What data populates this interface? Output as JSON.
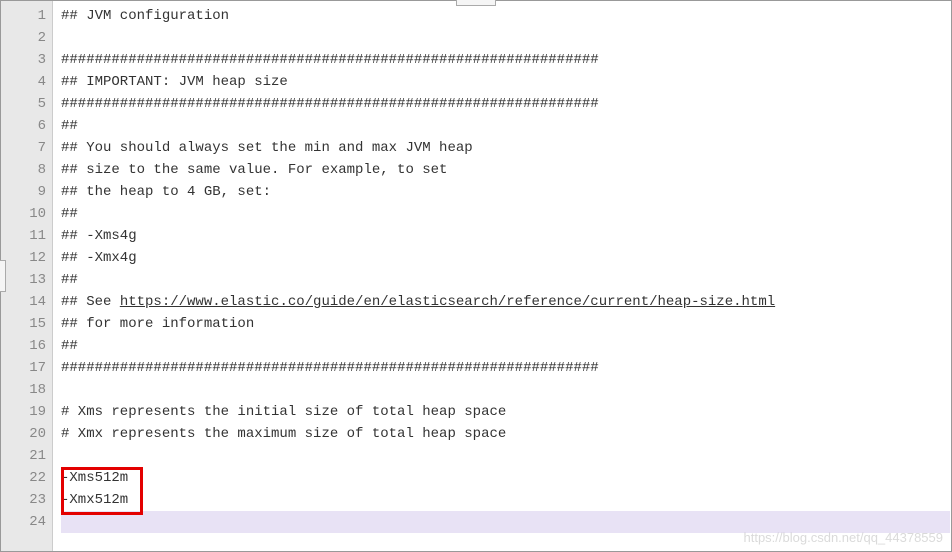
{
  "lines": [
    {
      "n": 1,
      "text": "## JVM configuration"
    },
    {
      "n": 2,
      "text": ""
    },
    {
      "n": 3,
      "text": "################################################################"
    },
    {
      "n": 4,
      "text": "## IMPORTANT: JVM heap size"
    },
    {
      "n": 5,
      "text": "################################################################"
    },
    {
      "n": 6,
      "text": "##"
    },
    {
      "n": 7,
      "text": "## You should always set the min and max JVM heap"
    },
    {
      "n": 8,
      "text": "## size to the same value. For example, to set"
    },
    {
      "n": 9,
      "text": "## the heap to 4 GB, set:"
    },
    {
      "n": 10,
      "text": "##"
    },
    {
      "n": 11,
      "text": "## -Xms4g"
    },
    {
      "n": 12,
      "text": "## -Xmx4g"
    },
    {
      "n": 13,
      "text": "##"
    },
    {
      "n": 14,
      "prefix": "## See ",
      "link": "https://www.elastic.co/guide/en/elasticsearch/reference/current/heap-size.html"
    },
    {
      "n": 15,
      "text": "## for more information"
    },
    {
      "n": 16,
      "text": "##"
    },
    {
      "n": 17,
      "text": "################################################################"
    },
    {
      "n": 18,
      "text": ""
    },
    {
      "n": 19,
      "text": "# Xms represents the initial size of total heap space"
    },
    {
      "n": 20,
      "text": "# Xmx represents the maximum size of total heap space"
    },
    {
      "n": 21,
      "text": ""
    },
    {
      "n": 22,
      "text": "-Xms512m"
    },
    {
      "n": 23,
      "text": "-Xmx512m"
    },
    {
      "n": 24,
      "text": ""
    }
  ],
  "watermark": "https://blog.csdn.net/qq_44378559"
}
